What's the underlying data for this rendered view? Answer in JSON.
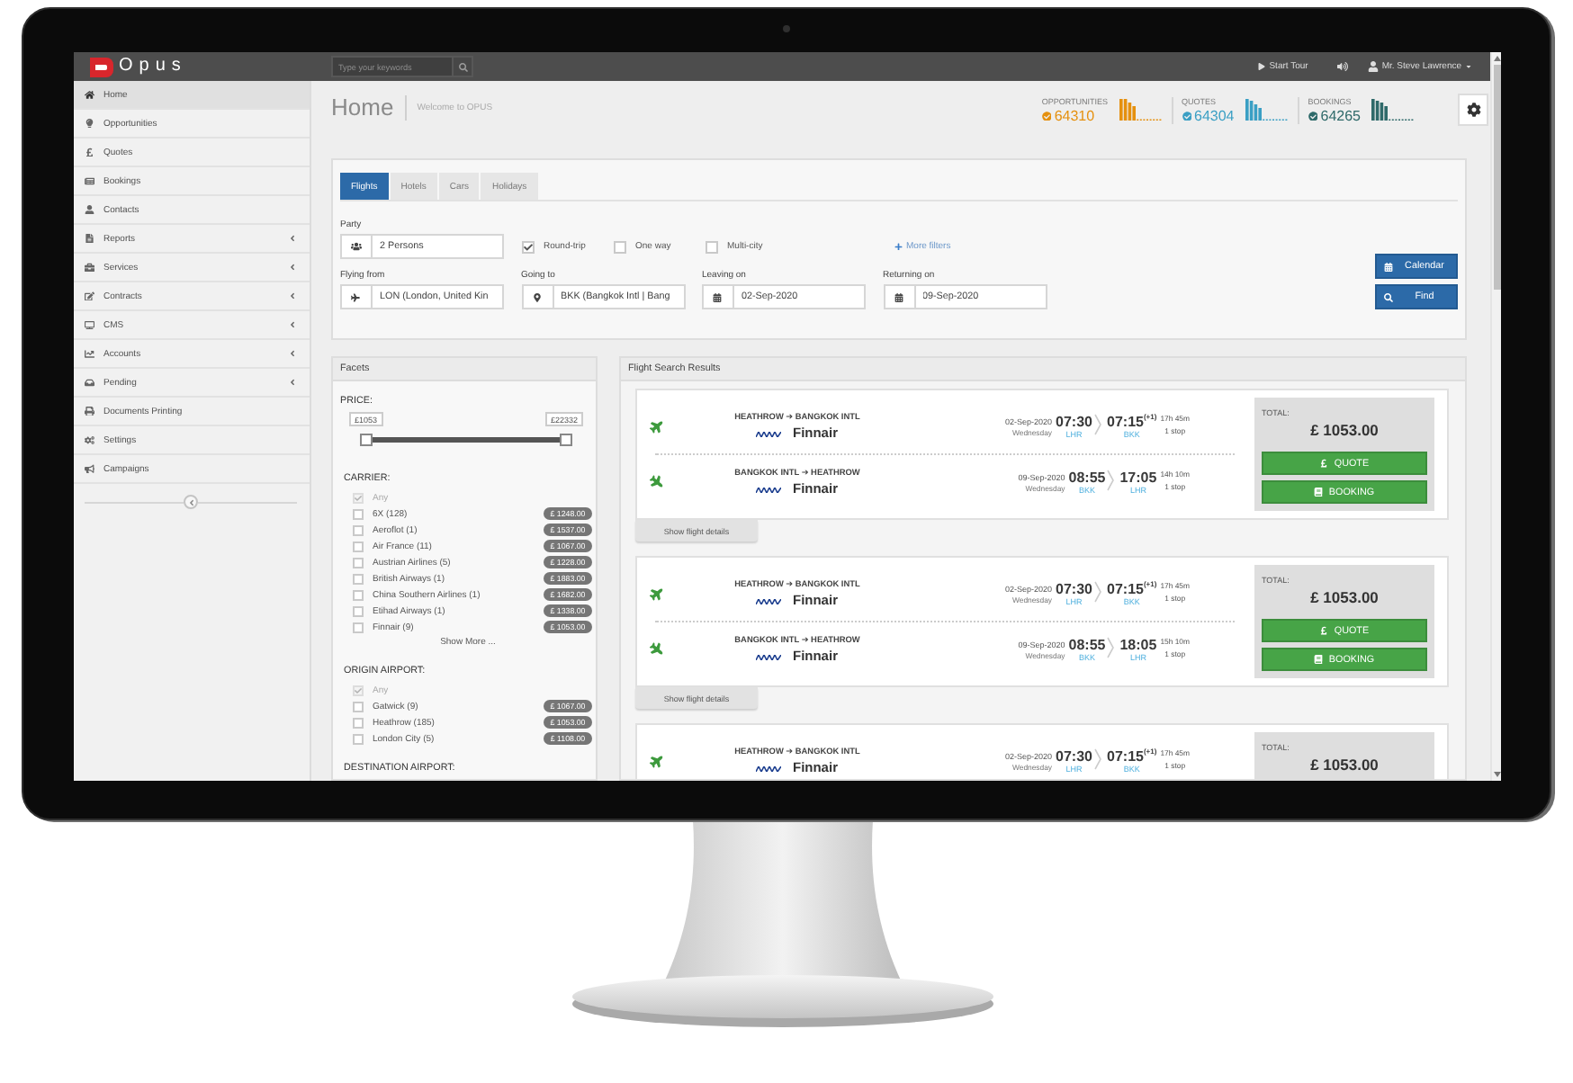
{
  "top_bar": {
    "logo": "Opus",
    "search": {
      "placeholder": "Type your keywords"
    },
    "tour": "Start Tour",
    "user": "Mr. Steve Lawrence"
  },
  "sidebar": {
    "items": [
      {
        "label": "Home",
        "selected": true,
        "expandable": false
      },
      {
        "label": "Opportunities",
        "selected": false,
        "expandable": false
      },
      {
        "label": "Quotes",
        "selected": false,
        "expandable": false
      },
      {
        "label": "Bookings",
        "selected": false,
        "expandable": false
      },
      {
        "label": "Contacts",
        "selected": false,
        "expandable": false
      },
      {
        "label": "Reports",
        "selected": false,
        "expandable": true
      },
      {
        "label": "Services",
        "selected": false,
        "expandable": true
      },
      {
        "label": "Contracts",
        "selected": false,
        "expandable": true
      },
      {
        "label": "CMS",
        "selected": false,
        "expandable": true
      },
      {
        "label": "Accounts",
        "selected": false,
        "expandable": true
      },
      {
        "label": "Pending",
        "selected": false,
        "expandable": true
      },
      {
        "label": "Documents Printing",
        "selected": false,
        "expandable": false
      },
      {
        "label": "Settings",
        "selected": false,
        "expandable": false
      },
      {
        "label": "Campaigns",
        "selected": false,
        "expandable": false
      }
    ]
  },
  "header": {
    "title": "Home",
    "subtitle": "Welcome to OPUS",
    "stats": [
      {
        "label": "OPPORTUNITIES",
        "value": "64310",
        "color": "#e5900e"
      },
      {
        "label": "QUOTES",
        "value": "64304",
        "color": "#3a9fc4"
      },
      {
        "label": "BOOKINGS",
        "value": "64265",
        "color": "#2f6a6a"
      }
    ]
  },
  "search_form": {
    "tabs": [
      {
        "label": "Flights",
        "selected": true
      },
      {
        "label": "Hotels",
        "selected": false
      },
      {
        "label": "Cars",
        "selected": false
      },
      {
        "label": "Holidays",
        "selected": false
      }
    ],
    "party": {
      "label": "Party",
      "value": "2 Persons"
    },
    "trip_types": [
      {
        "label": "Round-trip",
        "checked": true
      },
      {
        "label": "One way",
        "checked": false
      },
      {
        "label": "Multi-city",
        "checked": false
      }
    ],
    "more_filters": "More filters",
    "fields": [
      {
        "kind": "origin",
        "label": "Flying from",
        "value": "LON (London, United Kin"
      },
      {
        "kind": "destination",
        "label": "Going to",
        "value": "BKK (Bangkok Intl | Bang"
      },
      {
        "kind": "date",
        "label": "Leaving on",
        "value": "02-Sep-2020"
      },
      {
        "kind": "date",
        "label": "Returning on",
        "value": "09-Sep-2020"
      }
    ],
    "buttons": [
      {
        "label": "Calendar",
        "kind": "calendar"
      },
      {
        "label": "Find",
        "kind": "search"
      }
    ]
  },
  "facets": {
    "title": "Facets",
    "price": {
      "label": "PRICE:",
      "min": "£1053",
      "max": "£22332",
      "level": 1
    },
    "groups": [
      {
        "label": "CARRIER:",
        "options": [
          {
            "label": "Any",
            "checked": true,
            "disabled": true
          },
          {
            "label": "6X (128)",
            "checked": false,
            "disabled": false,
            "price": "£ 1248.00"
          },
          {
            "label": "Aeroflot (1)",
            "checked": false,
            "disabled": false,
            "price": "£ 1537.00"
          },
          {
            "label": "Air France (11)",
            "checked": false,
            "disabled": false,
            "price": "£ 1067.00"
          },
          {
            "label": "Austrian Airlines (5)",
            "checked": false,
            "disabled": false,
            "price": "£ 1228.00"
          },
          {
            "label": "British Airways (1)",
            "checked": false,
            "disabled": false,
            "price": "£ 1883.00"
          },
          {
            "label": "China Southern Airlines (1)",
            "checked": false,
            "disabled": false,
            "price": "£ 1682.00"
          },
          {
            "label": "Etihad Airways (1)",
            "checked": false,
            "disabled": false,
            "price": "£ 1338.00"
          },
          {
            "label": "Finnair (9)",
            "checked": false,
            "disabled": false,
            "price": "£ 1053.00"
          }
        ],
        "show_more": "Show More ..."
      },
      {
        "label": "ORIGIN AIRPORT:",
        "options": [
          {
            "label": "Any",
            "checked": true,
            "disabled": true
          },
          {
            "label": "Gatwick (9)",
            "checked": false,
            "disabled": false,
            "price": "£ 1067.00"
          },
          {
            "label": "Heathrow (185)",
            "checked": false,
            "disabled": false,
            "price": "£ 1053.00"
          },
          {
            "label": "London City (5)",
            "checked": false,
            "disabled": false,
            "price": "£ 1108.00"
          }
        ]
      },
      {
        "label": "DESTINATION AIRPORT:"
      }
    ]
  },
  "results": {
    "title": "Flight Search Results",
    "cards": [
      {
        "legs": [
          {
            "route": "HEATHROW ➔ BANGKOK INTL",
            "airline": "Finnair",
            "date": "02-Sep-2020",
            "weekday": "Wednesday",
            "depart": "07:30",
            "depart_code": "LHR",
            "arrive": "07:15$^{(+1)}$",
            "arrive_code": "BKK",
            "duration": "17h 45m",
            "stops": "1 stop"
          },
          {
            "route": "BANGKOK INTL ➔ HEATHROW",
            "airline": "Finnair",
            "date": "09-Sep-2020",
            "weekday": "Wednesday",
            "depart": "08:55",
            "depart_code": "BKK",
            "arrive": "17:05",
            "arrive_code": "LHR",
            "duration": "14h 10m",
            "stops": "1 stop"
          }
        ],
        "total_label": "TOTAL:",
        "total": "£ 1053.00",
        "actions": [
          {
            "label": "QUOTE",
            "kind": "quote"
          },
          {
            "label": "BOOKING",
            "kind": "booking"
          }
        ],
        "details": "Show flight details"
      },
      {
        "legs": [
          {
            "route": "HEATHROW ➔ BANGKOK INTL",
            "airline": "Finnair",
            "date": "02-Sep-2020",
            "weekday": "Wednesday",
            "depart": "07:30",
            "depart_code": "LHR",
            "arrive": "07:15$^{(+1)}$",
            "arrive_code": "BKK",
            "duration": "17h 45m",
            "stops": "1 stop"
          },
          {
            "route": "BANGKOK INTL ➔ HEATHROW",
            "airline": "Finnair",
            "date": "09-Sep-2020",
            "weekday": "Wednesday",
            "depart": "08:55",
            "depart_code": "BKK",
            "arrive": "18:05",
            "arrive_code": "LHR",
            "duration": "15h 10m",
            "stops": "1 stop"
          }
        ],
        "total_label": "TOTAL:",
        "total": "£ 1053.00",
        "actions": [
          {
            "label": "QUOTE",
            "kind": "quote"
          },
          {
            "label": "BOOKING",
            "kind": "booking"
          }
        ],
        "details": "Show flight details"
      },
      {
        "legs": [
          {
            "route": "HEATHROW ➔ BANGKOK INTL",
            "airline": "Finnair",
            "date": "02-Sep-2020",
            "weekday": "Wednesday",
            "depart": "07:30",
            "depart_code": "LHR",
            "arrive": "07:15$^{(+1)}$",
            "arrive_code": "BKK",
            "duration": "17h 45m",
            "stops": "1 stop"
          }
        ],
        "total_label": "TOTAL:",
        "total": "£ 1053.00"
      }
    ]
  }
}
